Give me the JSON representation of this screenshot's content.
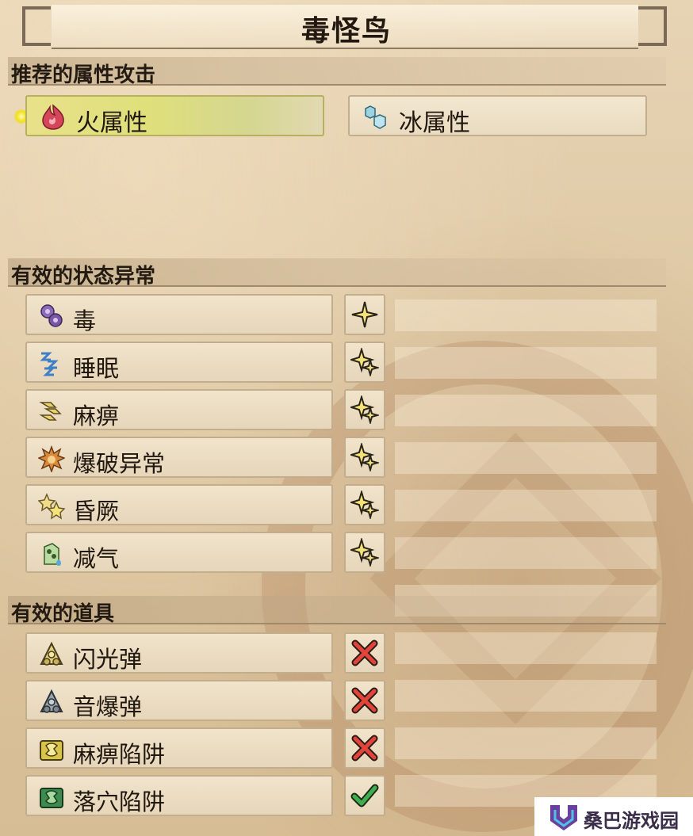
{
  "title": "毒怪鸟",
  "sections": {
    "elements": {
      "header": "推荐的属性攻击",
      "items": [
        {
          "label": "火属性",
          "icon": "fire-element-icon",
          "selected": true
        },
        {
          "label": "冰属性",
          "icon": "ice-element-icon",
          "selected": false
        }
      ]
    },
    "ailments": {
      "header": "有效的状态异常",
      "items": [
        {
          "label": "毒",
          "icon": "poison-icon",
          "stars": 1
        },
        {
          "label": "睡眠",
          "icon": "sleep-icon",
          "stars": 2
        },
        {
          "label": "麻痹",
          "icon": "paralysis-icon",
          "stars": 2
        },
        {
          "label": "爆破异常",
          "icon": "blast-icon",
          "stars": 2
        },
        {
          "label": "昏厥",
          "icon": "stun-icon",
          "stars": 2
        },
        {
          "label": "减气",
          "icon": "exhaust-icon",
          "stars": 2
        }
      ]
    },
    "items": {
      "header": "有效的道具",
      "items": [
        {
          "label": "闪光弹",
          "icon": "flash-pod-icon",
          "effective": false
        },
        {
          "label": "音爆弹",
          "icon": "sonic-bomb-icon",
          "effective": false
        },
        {
          "label": "麻痹陷阱",
          "icon": "shock-trap-icon",
          "effective": false
        },
        {
          "label": "落穴陷阱",
          "icon": "pitfall-trap-icon",
          "effective": true
        }
      ]
    }
  },
  "watermark": "桑巴游戏园",
  "colors": {
    "star": "#f4e27a",
    "cross": "#e0443a",
    "check": "#3fae4e"
  }
}
